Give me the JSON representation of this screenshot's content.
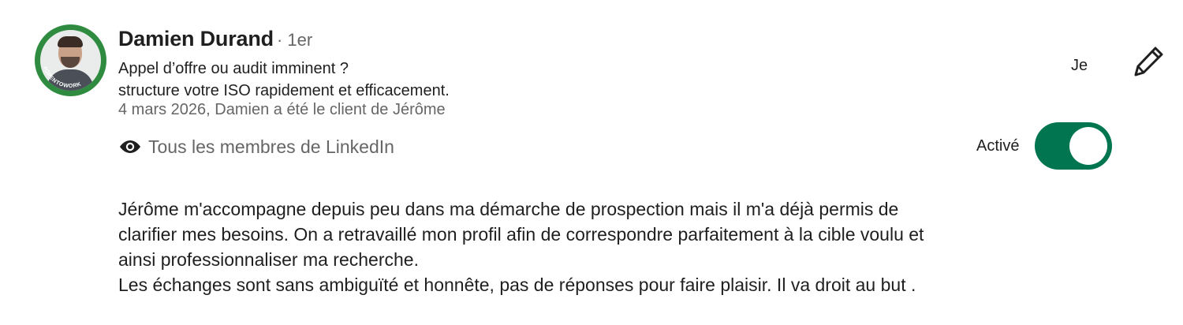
{
  "recommender": {
    "name": "Damien Durand",
    "degree": "· 1er",
    "headline_line1": "Appel d’offre ou audit imminent ?",
    "headline_line2": "structure votre ISO rapidement et efficacement.",
    "meta": "4 mars 2026, Damien a été le client de Jérôme",
    "avatar_badge": "#OPENTOWORK"
  },
  "visibility": {
    "icon": "eye-icon",
    "label": "Tous les membres de LinkedIn"
  },
  "controls": {
    "je_label": "Je",
    "edit_icon": "pencil-icon",
    "toggle_label": "Activé",
    "toggle_on": true,
    "toggle_color": "#01754f"
  },
  "recommendation": {
    "paragraph1": "Jérôme m'accompagne depuis peu dans ma démarche de prospection mais il m'a déjà permis de\nclarifier mes besoins. On a retravaillé mon profil afin de correspondre parfaitement à la cible voulu et\nainsi professionnaliser ma recherche.",
    "paragraph2": "Les échanges sont sans ambiguïté et honnête, pas de réponses pour faire plaisir. Il va droit au but ."
  }
}
